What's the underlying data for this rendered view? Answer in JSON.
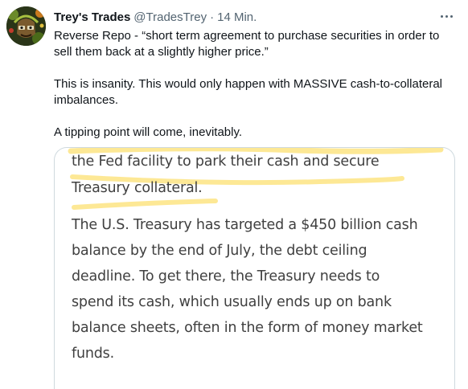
{
  "tweet": {
    "display_name": "Trey's Trades",
    "handle": "@TradesTrey",
    "separator": "·",
    "time": "14 Min.",
    "avatar_icon": "trader-avatar",
    "more_icon": "more-options-icon",
    "paragraphs": [
      "Reverse Repo - “short term agreement to purchase securities in order to sell them back at a slightly higher price.”",
      "This is insanity. This would only happen with MASSIVE cash-to-collateral imbalances.",
      "A tipping point will come, inevitably."
    ]
  },
  "media": {
    "highlight_color": "#fde68a",
    "paragraph1_lines": [
      "the Fed facility to park their cash and secure",
      "Treasury collateral."
    ],
    "paragraph2_lines": [
      "The U.S. Treasury has targeted a $450 billion cash",
      "balance by the end of July, the debt ceiling",
      "deadline. To get there, the Treasury needs to",
      "spend its cash, which usually ends up on bank",
      "balance sheets, often in the form of money market",
      "funds."
    ]
  }
}
